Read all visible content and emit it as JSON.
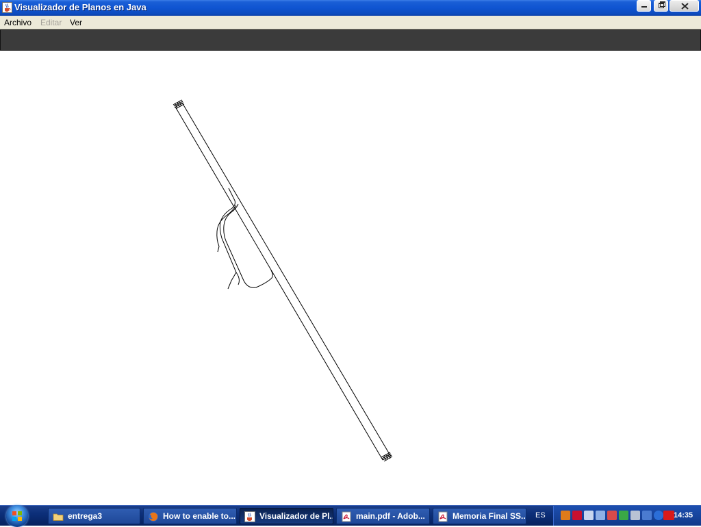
{
  "window": {
    "title": "Visualizador de Planos en Java",
    "title_icon": "java-cup-icon",
    "controls": [
      "minimize-icon",
      "maximize-icon",
      "close-icon"
    ]
  },
  "menubar": {
    "items": [
      {
        "label": "Archivo",
        "enabled": true
      },
      {
        "label": "Editar",
        "enabled": false
      },
      {
        "label": "Ver",
        "enabled": true
      }
    ]
  },
  "toolbar": {
    "color": "#3b3b3b"
  },
  "canvas": {
    "background": "#ffffff",
    "stroke_color": "#000000"
  },
  "taskbar": {
    "start_icon": "windows-orb-icon",
    "buttons": [
      {
        "label": "entrega3",
        "icon": "folder-icon",
        "active": false
      },
      {
        "label": "How to enable to...",
        "icon": "firefox-icon",
        "active": false
      },
      {
        "label": "Visualizador de Pl...",
        "icon": "java-cup-icon",
        "active": true
      },
      {
        "label": "main.pdf - Adob...",
        "icon": "pdf-icon",
        "active": false
      },
      {
        "label": "Memoria Final SS...",
        "icon": "pdf-icon",
        "active": false
      }
    ],
    "language": "ES",
    "tray_icons": [
      "java-tray-icon",
      "adobe-tray-icon",
      "volume-icon",
      "network-icon",
      "network-icon-2",
      "sync-icon",
      "safely-remove-icon",
      "monitor-icon",
      "globe-icon",
      "ati-icon"
    ],
    "clock": "14:35"
  }
}
